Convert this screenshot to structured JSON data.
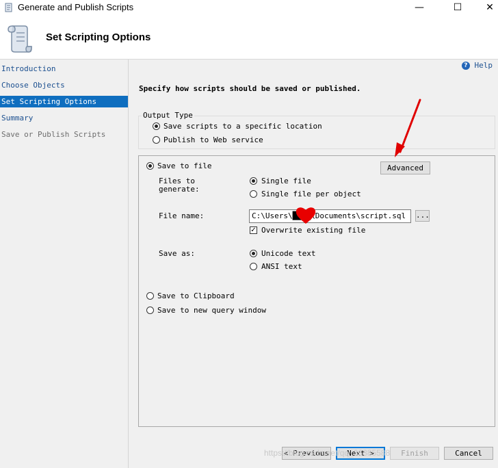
{
  "window": {
    "title": "Generate and Publish Scripts",
    "minimize": "—",
    "maximize": "☐",
    "close": "✕"
  },
  "header": {
    "title": "Set Scripting Options"
  },
  "sidebar": {
    "items": [
      {
        "label": "Introduction",
        "state": "link"
      },
      {
        "label": "Choose Objects",
        "state": "link"
      },
      {
        "label": "Set Scripting Options",
        "state": "active"
      },
      {
        "label": "Summary",
        "state": "link"
      },
      {
        "label": "Save or Publish Scripts",
        "state": "disabled"
      }
    ]
  },
  "main": {
    "help_label": "Help",
    "instruction": "Specify how scripts should be saved or published.",
    "output_type": {
      "label": "Output Type",
      "options": [
        "Save scripts to a specific location",
        "Publish to Web service"
      ],
      "selected": 0
    },
    "save_to_file": {
      "label": "Save to file",
      "advanced_button": "Advanced",
      "files_to_generate_label": "Files to generate:",
      "file_options": [
        "Single file",
        "Single file per object"
      ],
      "file_selected": 0,
      "file_name_label": "File name:",
      "file_name_value": "C:\\Users\\████\\Documents\\script.sql",
      "browse_button": "...",
      "overwrite_label": "Overwrite existing file",
      "overwrite_checked": true,
      "save_as_label": "Save as:",
      "save_as_options": [
        "Unicode text",
        "ANSI text"
      ],
      "save_as_selected": 0
    },
    "other_options": [
      "Save to Clipboard",
      "Save to new query window"
    ]
  },
  "footer": {
    "previous": "< Previous",
    "next": "Next >",
    "finish": "Finish",
    "cancel": "Cancel"
  },
  "colors": {
    "accent": "#0f6ebf",
    "link": "#1b4f8f",
    "annotation_arrow": "#e00000"
  },
  "icons": [
    "scroll-icon",
    "help-icon",
    "red-arrow-annotation",
    "red-heart-redaction"
  ],
  "watermark": "https://blog.csdn.net/qq_36385588"
}
